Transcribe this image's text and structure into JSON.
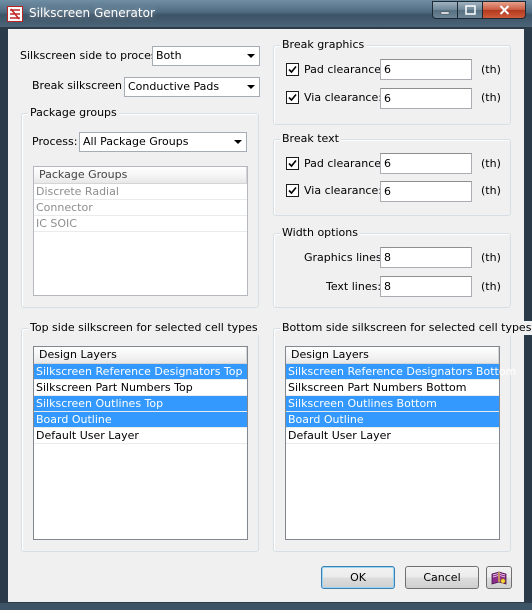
{
  "window": {
    "title": "Silkscreen Generator"
  },
  "side": {
    "label": "Silkscreen side to process:",
    "value": "Both"
  },
  "break_silkscreen": {
    "label": "Break silkscreen",
    "value": "Conductive Pads"
  },
  "package_groups": {
    "title": "Package groups",
    "process_label": "Process:",
    "process_value": "All Package Groups",
    "list_header": "Package Groups",
    "items": [
      "Discrete Radial",
      "Connector",
      "IC SOIC"
    ]
  },
  "break_graphics": {
    "title": "Break graphics",
    "pad_label": "Pad clearance:",
    "pad_value": "6",
    "pad_unit": "(th)",
    "via_label": "Via clearance:",
    "via_value": "6",
    "via_unit": "(th)"
  },
  "break_text": {
    "title": "Break text",
    "pad_label": "Pad clearance:",
    "pad_value": "6",
    "pad_unit": "(th)",
    "via_label": "Via clearance:",
    "via_value": "6",
    "via_unit": "(th)"
  },
  "width_options": {
    "title": "Width options",
    "graphics_label": "Graphics lines:",
    "graphics_value": "8",
    "graphics_unit": "(th)",
    "text_label": "Text lines:",
    "text_value": "8",
    "text_unit": "(th)"
  },
  "top_side": {
    "title": "Top side silkscreen for selected cell types",
    "header": "Design Layers",
    "rows": [
      {
        "label": "Silkscreen Reference Designators Top"
      },
      {
        "label": "Silkscreen Part Numbers Top"
      },
      {
        "label": "Silkscreen Outlines Top"
      },
      {
        "label": "Board Outline"
      },
      {
        "label": "Default User Layer"
      }
    ]
  },
  "bottom_side": {
    "title": "Bottom side silkscreen for selected cell types",
    "header": "Design Layers",
    "rows": [
      {
        "label": "Silkscreen Reference Designators Bottom"
      },
      {
        "label": "Silkscreen Part Numbers Bottom"
      },
      {
        "label": "Silkscreen Outlines Bottom"
      },
      {
        "label": "Board Outline"
      },
      {
        "label": "Default User Layer"
      }
    ]
  },
  "buttons": {
    "ok": "OK",
    "cancel": "Cancel"
  }
}
